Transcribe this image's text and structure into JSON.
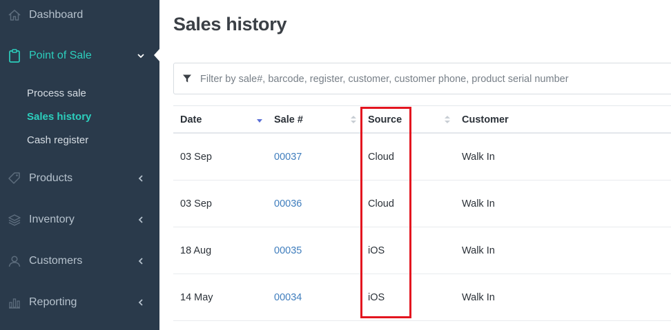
{
  "sidebar": {
    "items": [
      {
        "label": "Dashboard",
        "icon": "home-icon"
      },
      {
        "label": "Point of Sale",
        "icon": "clipboard-icon",
        "active": true,
        "expanded": true
      },
      {
        "label": "Products",
        "icon": "tag-icon"
      },
      {
        "label": "Inventory",
        "icon": "layers-icon"
      },
      {
        "label": "Customers",
        "icon": "users-icon"
      },
      {
        "label": "Reporting",
        "icon": "bar-chart-icon"
      }
    ],
    "pos_subitems": [
      {
        "label": "Process sale"
      },
      {
        "label": "Sales history",
        "active": true
      },
      {
        "label": "Cash register"
      }
    ]
  },
  "page": {
    "title": "Sales history"
  },
  "filter": {
    "placeholder": "Filter by sale#, barcode, register, customer, customer phone, product serial number",
    "value": ""
  },
  "table": {
    "columns": [
      "Date",
      "Sale #",
      "Source",
      "Customer"
    ],
    "sorted_column": "Date",
    "sort_direction": "descending",
    "rows": [
      {
        "date": "03 Sep",
        "sale": "00037",
        "source": "Cloud",
        "customer": "Walk In"
      },
      {
        "date": "03 Sep",
        "sale": "00036",
        "source": "Cloud",
        "customer": "Walk In"
      },
      {
        "date": "18 Aug",
        "sale": "00035",
        "source": "iOS",
        "customer": "Walk In"
      },
      {
        "date": "14 May",
        "sale": "00034",
        "source": "iOS",
        "customer": "Walk In"
      }
    ]
  },
  "colors": {
    "sidebar_bg": "#2a3a4b",
    "accent": "#2ccfbd",
    "link": "#3f7dbd",
    "highlight": "#e3151f"
  }
}
